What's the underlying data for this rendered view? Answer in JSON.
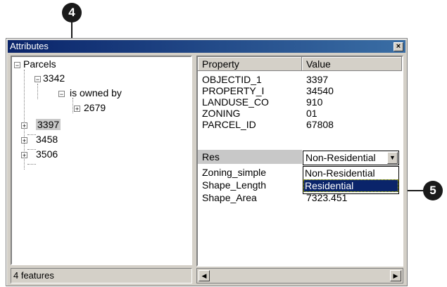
{
  "callouts": {
    "step4": "4",
    "step5": "5"
  },
  "window": {
    "title": "Attributes",
    "close_glyph": "×"
  },
  "tree": {
    "root": "Parcels",
    "items": [
      "3342",
      "is owned by",
      "2679",
      "3397",
      "3458",
      "3506"
    ],
    "expand": "+",
    "collapse": "−"
  },
  "status": {
    "text": "4 features"
  },
  "properties": {
    "headers": {
      "property": "Property",
      "value": "Value"
    },
    "rows": [
      {
        "property": "OBJECTID_1",
        "value": "3397"
      },
      {
        "property": "PROPERTY_I",
        "value": "34540"
      },
      {
        "property": "LANDUSE_CO",
        "value": "910"
      },
      {
        "property": "ZONING",
        "value": "01"
      },
      {
        "property": "PARCEL_ID",
        "value": "67808"
      },
      {
        "property": "Res",
        "value": "Non-Residential"
      },
      {
        "property": "Zoning_simple",
        "value": ""
      },
      {
        "property": "Shape_Length",
        "value": ""
      },
      {
        "property": "Shape_Area",
        "value": "7323.451"
      }
    ],
    "dropdown_options": [
      "Non-Residential",
      "Residential"
    ],
    "selected_option": "Residential"
  },
  "colors": {
    "titlebar": "#0a246a",
    "selection": "#0a246a",
    "callout": "#1a1a1a"
  }
}
